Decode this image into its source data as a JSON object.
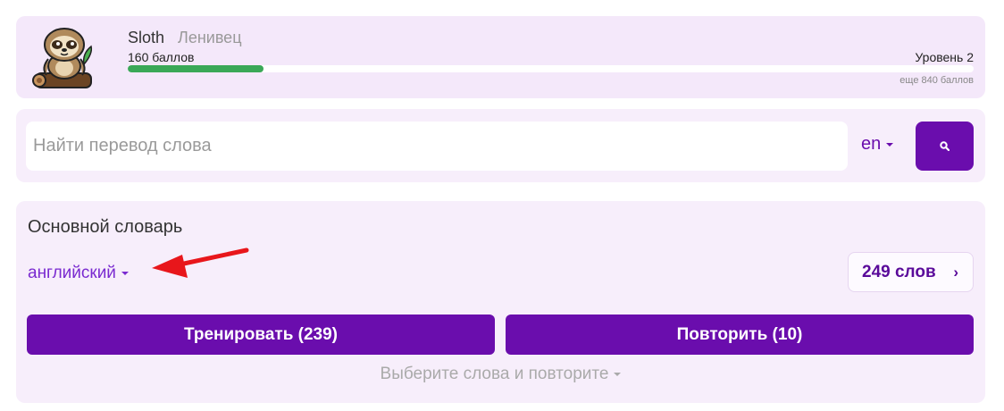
{
  "profile": {
    "name": "Sloth",
    "rank": "Ленивец",
    "points": "160 баллов",
    "level": "Уровень 2",
    "remaining": "еще 840 баллов",
    "progress_fraction": 0.16,
    "progress_color": "#3aa857",
    "avatar_icon": "sloth-mascot"
  },
  "search": {
    "placeholder": "Найти перевод слова",
    "value": "",
    "language": "en",
    "button_icon": "search-icon"
  },
  "dictionary": {
    "title": "Основной словарь",
    "language": "английский",
    "words_count": "249 слов",
    "train_label": "Тренировать (239)",
    "repeat_label": "Повторить (10)",
    "select_repeat_label": "Выберите слова и повторите"
  },
  "colors": {
    "accent": "#6a0dad",
    "card_bg": "#f7eefb",
    "annotation_arrow": "#e8161b"
  }
}
